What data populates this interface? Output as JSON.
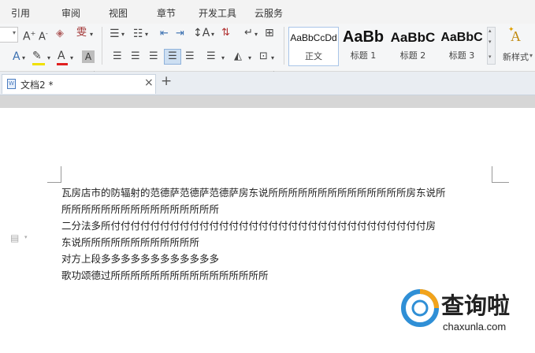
{
  "menu": {
    "items": [
      "引用",
      "审阅",
      "视图",
      "章节",
      "开发工具",
      "云服务"
    ]
  },
  "ribbon": {
    "styles": [
      {
        "preview": "AaBbCcDd",
        "name": "正文",
        "selected": true
      },
      {
        "preview": "AaBb",
        "name": "标题 1"
      },
      {
        "preview": "AaBbC",
        "name": "标题 2"
      },
      {
        "preview": "AaBbC",
        "name": "标题 3"
      }
    ],
    "new_style_label": "新样式"
  },
  "tabs": {
    "document_title": "文档2 *",
    "close_glyph": "×",
    "new_tab_glyph": "+"
  },
  "document": {
    "lines": [
      "瓦房店市的防辐射的范德萨范德萨范德萨房东说所所所所所所所所所所所所所所房东说所",
      "所所所所所所所所所所所所所所所所",
      "二分法多所付付付付付付付付付付付付付付付付付付付付付付付付付付付付付付付付房",
      "东说所所所所所所所所所所所所",
      "对方上段多多多多多多多多多多多多",
      "歌功颂德过所所所所所所所所所所所所所所所所"
    ]
  },
  "watermark": {
    "brand": "查询啦",
    "url": "chaxunla.com"
  }
}
